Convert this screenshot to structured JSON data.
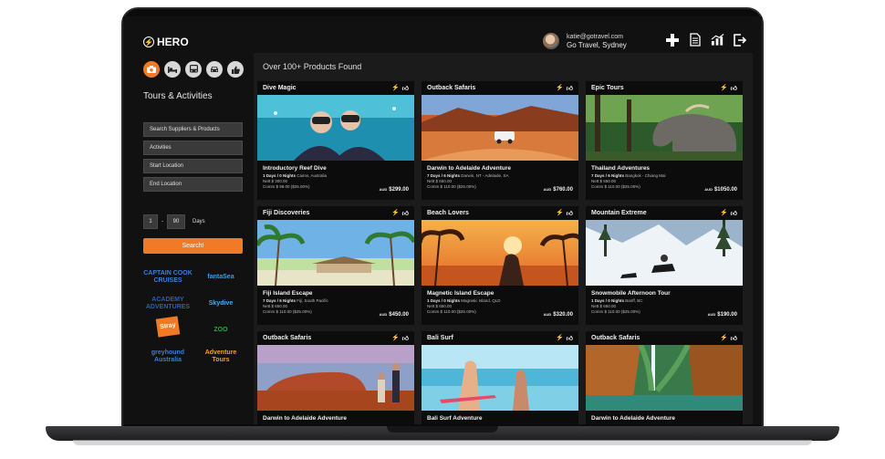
{
  "app": {
    "logo_text": "HERO",
    "user_email": "katie@gotravel.com",
    "company": "Go Travel, Sydney",
    "top_icons": [
      "plus-icon",
      "document-icon",
      "chart-icon",
      "logout-icon"
    ]
  },
  "sidebar": {
    "categories": [
      "camera-icon",
      "bed-icon",
      "bus-icon",
      "car-icon",
      "thumbs-up-icon"
    ],
    "active_category": 0,
    "title": "Tours & Activities",
    "search_placeholder": "Search Suppliers & Products",
    "activities_label": "Activities",
    "start_location_label": "Start Location",
    "end_location_label": "End Location",
    "days_min": "1",
    "days_separator": "-",
    "days_max": "90",
    "days_label": "Days",
    "search_button": "Search!",
    "partners": [
      {
        "name": "CAPTAIN COOK CRUISES",
        "color": "#3a7fd5"
      },
      {
        "name": "fantaSea",
        "color": "#3aa0e0"
      },
      {
        "name": "ACADEMY ADVENTURES",
        "color": "#2b5fb0"
      },
      {
        "name": "Skydive",
        "color": "#4fa9e8"
      },
      {
        "name": "Stray",
        "color": "#f07a25"
      },
      {
        "name": "ZOO",
        "color": "#3aa04a"
      },
      {
        "name": "greyhound Australia",
        "color": "#3a7fd5"
      },
      {
        "name": "Adventure Tours",
        "color": "#f0a020"
      }
    ],
    "accent": "#f07a25"
  },
  "main": {
    "results_title": "Over 100+ Products Found",
    "cards": [
      {
        "header": "Dive Magic",
        "title": "Introductory Reef Dive",
        "duration": "1 Days / 0 Nights",
        "route": "Cairns, Australia",
        "nett": "Nett $ 300.00",
        "comm": "Comm $ 99.00 ($25.00%)",
        "currency": "AUD",
        "price": "$299.00",
        "scene": "dive"
      },
      {
        "header": "Outback Safaris",
        "title": "Darwin to Adelaide Adventure",
        "duration": "7 Days / 6 Nights",
        "route": "Darwin, NT - Adelaide, SA",
        "nett": "Nett $ 650.00",
        "comm": "Comm $ 110.00 ($25.00%)",
        "currency": "AUD",
        "price": "$760.00",
        "scene": "outback"
      },
      {
        "header": "Epic Tours",
        "title": "Thailand Adventures",
        "duration": "7 Days / 6 Nights",
        "route": "Bangkok - Chiang Mai",
        "nett": "Nett $ 650.00",
        "comm": "Comm $ 110.00 ($25.00%)",
        "currency": "AUD",
        "price": "$1050.00",
        "scene": "elephant"
      },
      {
        "header": "Fiji Discoveries",
        "title": "Fiji Island Escape",
        "duration": "7 Days / 6 Nights",
        "route": "Fiji, South Pacific",
        "nett": "Nett $ 650.00",
        "comm": "Comm $ 110.00 ($25.00%)",
        "currency": "AUD",
        "price": "$450.00",
        "scene": "fiji"
      },
      {
        "header": "Beach Lovers",
        "title": "Magnetic Island Escape",
        "duration": "1 Days / 0 Nights",
        "route": "Magnetic Island, QLD",
        "nett": "Nett $ 650.00",
        "comm": "Comm $ 110.00 ($25.00%)",
        "currency": "AUD",
        "price": "$320.00",
        "scene": "sunset"
      },
      {
        "header": "Mountain Extreme",
        "title": "Snowmobile Afternoon Tour",
        "duration": "1 Days / 0 Nights",
        "route": "Banff, BC",
        "nett": "Nett $ 650.00",
        "comm": "Comm $ 110.00 ($25.00%)",
        "currency": "AUD",
        "price": "$190.00",
        "scene": "snow"
      },
      {
        "header": "Outback Safaris",
        "title": "Darwin to Adelaide Adventure",
        "duration": "",
        "route": "",
        "nett": "",
        "comm": "",
        "currency": "",
        "price": "",
        "scene": "uluru"
      },
      {
        "header": "Bali Surf",
        "title": "Bali Surf Adventure",
        "duration": "",
        "route": "",
        "nett": "",
        "comm": "",
        "currency": "",
        "price": "",
        "scene": "surf"
      },
      {
        "header": "Outback Safaris",
        "title": "Darwin to Adelaide Adventure",
        "duration": "",
        "route": "",
        "nett": "",
        "comm": "",
        "currency": "",
        "price": "",
        "scene": "gorge"
      }
    ]
  }
}
